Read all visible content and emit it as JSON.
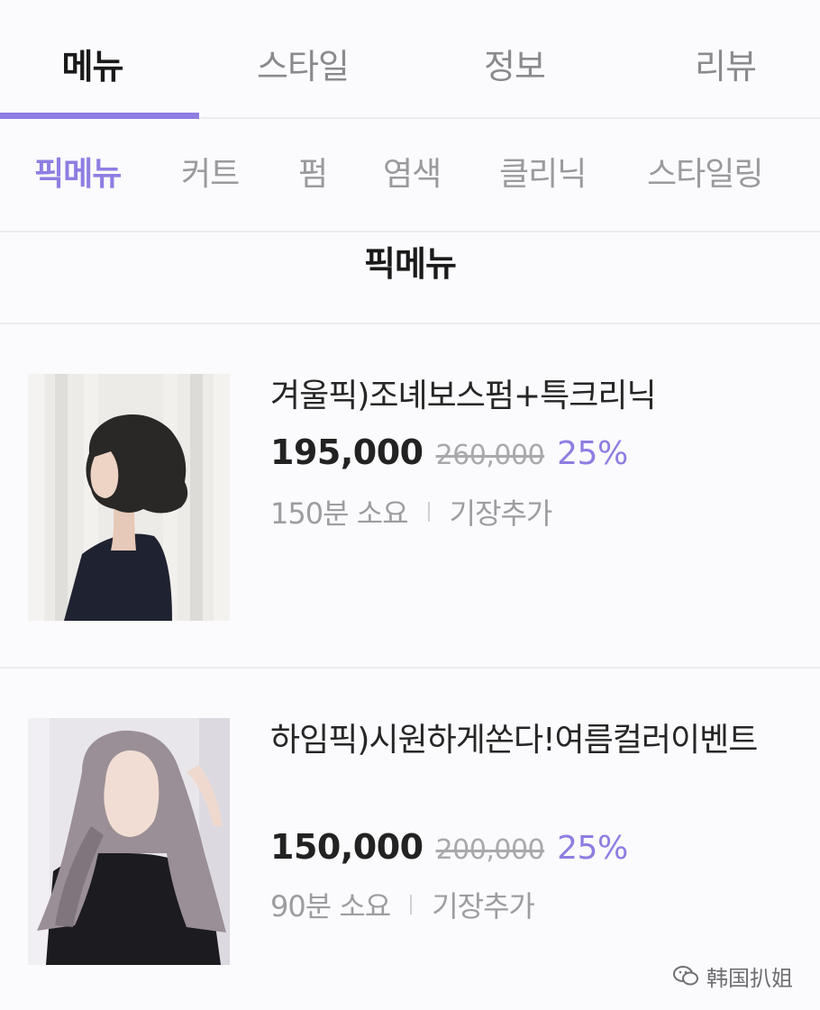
{
  "top_tabs": [
    {
      "label": "메뉴",
      "active": true
    },
    {
      "label": "스타일",
      "active": false
    },
    {
      "label": "정보",
      "active": false
    },
    {
      "label": "리뷰",
      "active": false
    }
  ],
  "sub_tabs": [
    {
      "label": "픽메뉴",
      "active": true
    },
    {
      "label": "커트",
      "active": false
    },
    {
      "label": "펌",
      "active": false
    },
    {
      "label": "염색",
      "active": false
    },
    {
      "label": "클리닉",
      "active": false
    },
    {
      "label": "스타일링",
      "active": false
    }
  ],
  "section": {
    "title": "픽메뉴"
  },
  "items": [
    {
      "name": "겨울픽)조녜보스펌+특크리닉",
      "price": "195,000",
      "original_price": "260,000",
      "discount": "25%",
      "duration": "150분 소요",
      "extra": "기장추가"
    },
    {
      "name": "하임픽)시원하게쏜다!여름컬러이벤트",
      "price": "150,000",
      "original_price": "200,000",
      "discount": "25%",
      "duration": "90분 소요",
      "extra": "기장추가"
    }
  ],
  "watermark": {
    "text": "韩国扒姐",
    "icon": "wechat-icon"
  },
  "colors": {
    "accent": "#8d7ee2",
    "text": "#222222",
    "muted": "#9d9da1",
    "divider": "#ececef"
  }
}
